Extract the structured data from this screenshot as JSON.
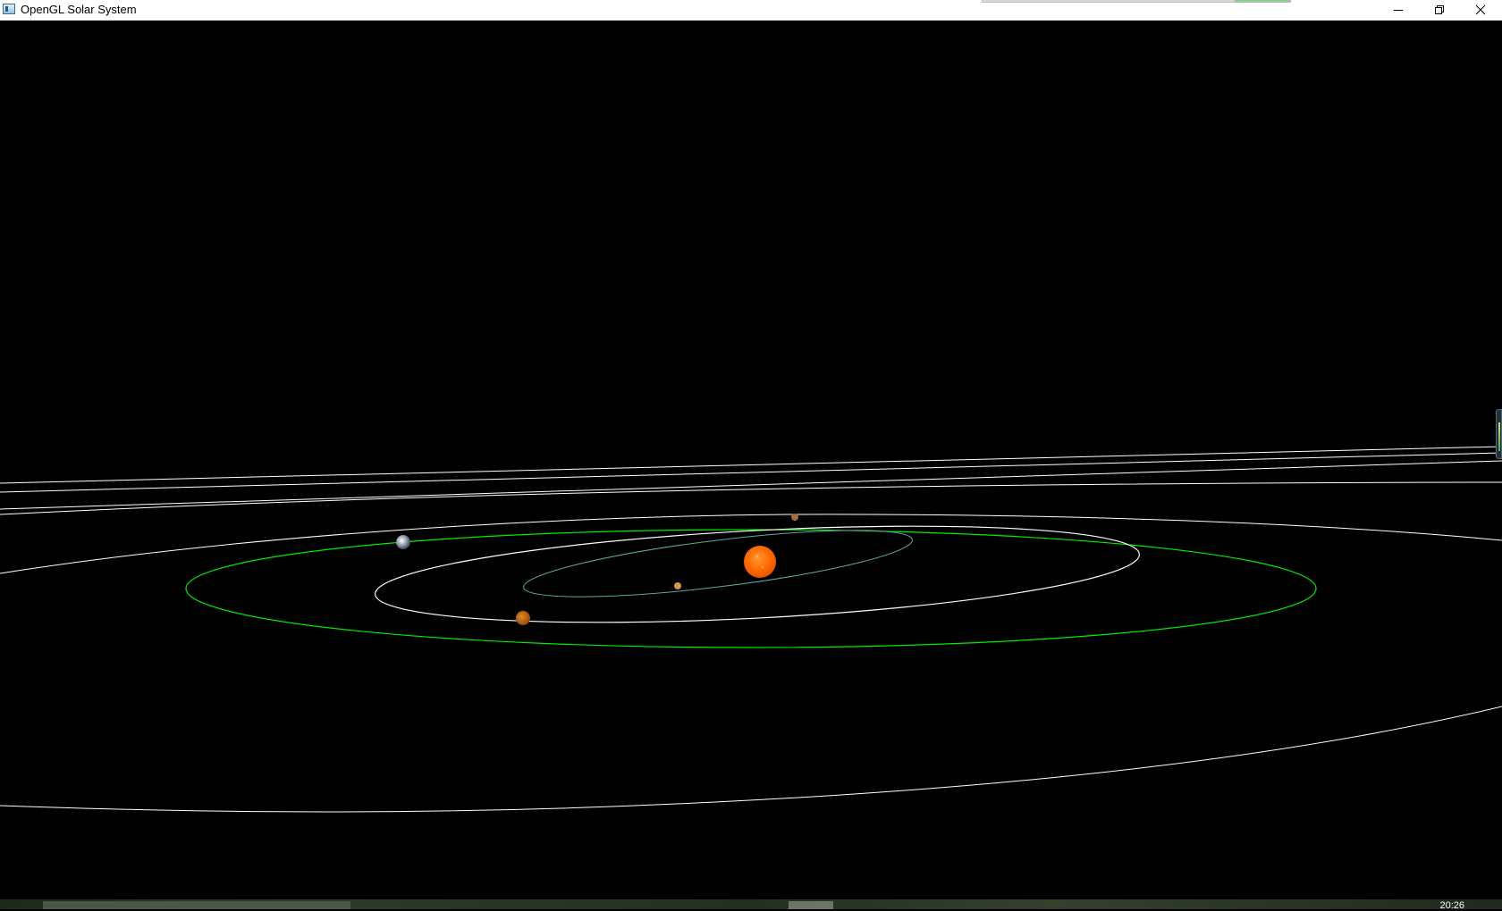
{
  "window": {
    "title": "OpenGL Solar System",
    "icon": "opengl-app-icon",
    "controls": {
      "minimize_icon": "minimize-icon",
      "restore_icon": "restore-icon",
      "close_icon": "close-icon"
    }
  },
  "scene": {
    "background_color": "#000000",
    "orbit_color_white": "#ffffff",
    "orbit_color_green": "#00ff00",
    "orbit_color_teal": "#5fa8a0",
    "sun_color": "#ff6a00",
    "bodies": [
      "sun",
      "mercury",
      "venus",
      "earth",
      "mars",
      "outer-body"
    ]
  },
  "taskbar": {
    "clock": "20:26"
  }
}
